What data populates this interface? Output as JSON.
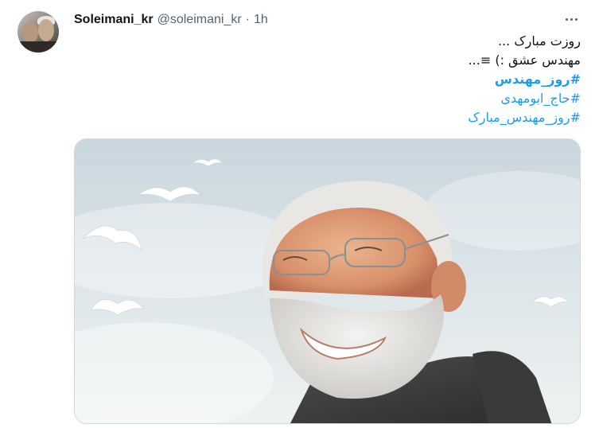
{
  "tweet": {
    "author_name": "Soleimani_kr",
    "handle": "@soleimani_kr",
    "separator": "·",
    "time": "1h",
    "lines": [
      "روزت مبارک ...",
      "مهندس عشق :) ≡..."
    ],
    "hashtags": [
      "#روز_مهندس",
      "#حاج_ابومهدی",
      "#روز_مهندس_مبارک"
    ]
  },
  "icons": {
    "more": "more-options-icon"
  },
  "colors": {
    "link": "#1d9bf0",
    "text": "#0f1419",
    "muted": "#536471"
  }
}
